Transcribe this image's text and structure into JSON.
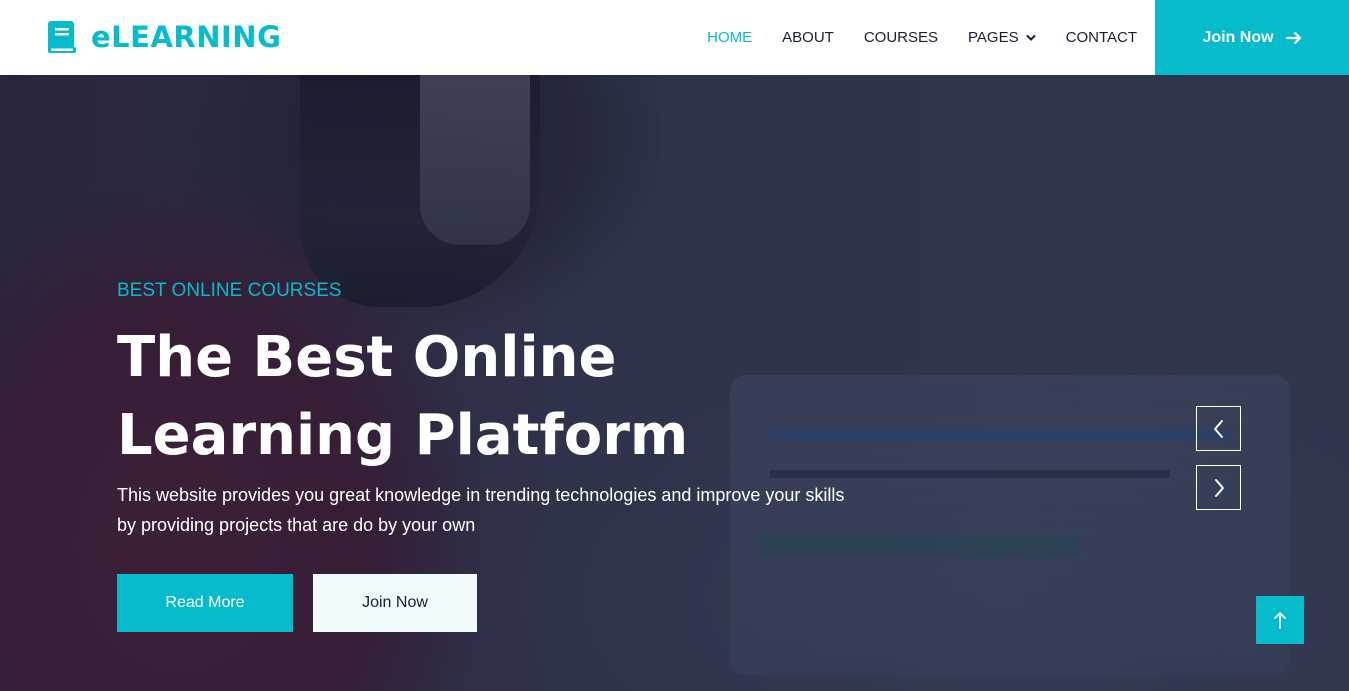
{
  "brand": {
    "name": "eLEARNING",
    "icon": "book-icon"
  },
  "nav": {
    "items": [
      {
        "label": "HOME",
        "active": true
      },
      {
        "label": "ABOUT",
        "active": false
      },
      {
        "label": "COURSES",
        "active": false
      },
      {
        "label": "PAGES",
        "active": false,
        "dropdown": true
      },
      {
        "label": "CONTACT",
        "active": false
      }
    ],
    "cta": {
      "label": "Join Now",
      "icon": "arrow-right-icon"
    }
  },
  "hero": {
    "eyebrow": "BEST ONLINE COURSES",
    "title": "The Best Online Learning Platform",
    "description": "This website provides you great knowledge in trending technologies and improve your skills by providing projects that are do by your own",
    "primary_button": "Read More",
    "secondary_button": "Join Now"
  },
  "carousel": {
    "prev_icon": "chevron-left-icon",
    "next_icon": "chevron-right-icon"
  },
  "back_to_top": {
    "icon": "arrow-up-icon"
  },
  "colors": {
    "accent": "#06BBCC",
    "dark": "#181d38",
    "light": "#F0FBFC"
  }
}
